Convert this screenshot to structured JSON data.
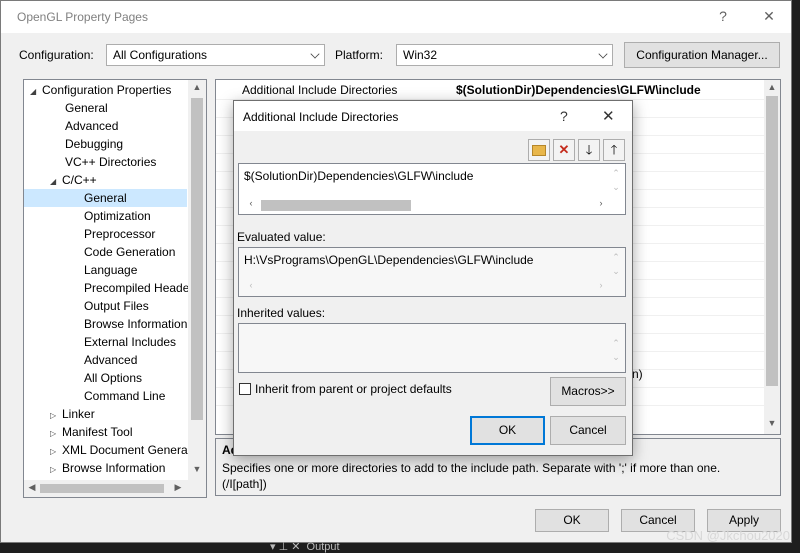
{
  "window": {
    "title": "OpenGL Property Pages",
    "help": "?",
    "close": "✕"
  },
  "config": {
    "label": "Configuration:",
    "value": "All Configurations"
  },
  "platform": {
    "label": "Platform:",
    "value": "Win32"
  },
  "config_manager_button": "Configuration Manager...",
  "tree": {
    "root": "Configuration Properties",
    "items": [
      "General",
      "Advanced",
      "Debugging",
      "VC++ Directories",
      "C/C++",
      "General",
      "Optimization",
      "Preprocessor",
      "Code Generation",
      "Language",
      "Precompiled Heade",
      "Output Files",
      "Browse Information",
      "External Includes",
      "Advanced",
      "All Options",
      "Command Line",
      "Linker",
      "Manifest Tool",
      "XML Document Genera",
      "Browse Information"
    ]
  },
  "grid": {
    "row_name": "Additional Include Directories",
    "row_value": "$(SolutionDir)Dependencies\\GLFW\\include",
    "obscured_fragment": "n)"
  },
  "description": {
    "title_fragment": "Ad",
    "text": "Specifies one or more directories to add to the include path. Separate with ';' if more than one.",
    "switch": "(/I[path])"
  },
  "buttons": {
    "ok": "OK",
    "cancel": "Cancel",
    "apply": "Apply"
  },
  "dialog": {
    "title": "Additional Include Directories",
    "help": "?",
    "close": "✕",
    "entry": "$(SolutionDir)Dependencies\\GLFW\\include",
    "evaluated_label": "Evaluated value:",
    "evaluated_value": "H:\\VsPrograms\\OpenGL\\Dependencies\\GLFW\\include",
    "inherited_label": "Inherited values:",
    "inherit_checkbox": "Inherit from parent or project defaults",
    "inherit_checked": false,
    "macros_button": "Macros>>",
    "ok": "OK",
    "cancel": "Cancel"
  },
  "background": {
    "output_tab": "Output"
  },
  "watermark": "CSDN @Jkchou2020",
  "colors": {
    "selection": "#cce8ff",
    "default_button_border": "#0078d7",
    "delete_red": "#c42b1c",
    "folder_yellow": "#e8b64a"
  }
}
